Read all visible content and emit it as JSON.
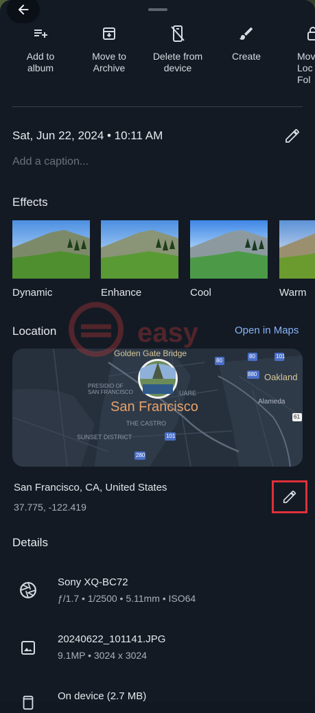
{
  "header": {
    "back_label": "Back"
  },
  "actions": [
    {
      "label": "Add to\nalbum",
      "icon": "playlist-add-icon"
    },
    {
      "label": "Move to\nArchive",
      "icon": "archive-icon"
    },
    {
      "label": "Delete from\ndevice",
      "icon": "phone-erase-icon"
    },
    {
      "label": "Create",
      "icon": "brush-icon"
    },
    {
      "label": "Move\nLoc\nFol",
      "icon": "lock-folder-icon"
    }
  ],
  "info": {
    "date": "Sat, Jun 22, 2024 • 10:11 AM",
    "caption_placeholder": "Add a caption..."
  },
  "effects": {
    "title": "Effects",
    "items": [
      "Dynamic",
      "Enhance",
      "Cool",
      "Warm"
    ]
  },
  "location": {
    "title": "Location",
    "open_maps": "Open in Maps",
    "place": "San Francisco, CA, United States",
    "coords": "37.775, -122.419",
    "map": {
      "city": "San Francisco",
      "golden_gate": "Golden Gate Bridge",
      "oakland": "Oakland",
      "alameda": "Alameda",
      "presidio": "PRESIDIO OF\nSAN FRANCISCO",
      "castro": "THE CASTRO",
      "sunset": "SUNSET DISTRICT",
      "square": "UARE",
      "shields": [
        "80",
        "80",
        "880",
        "280",
        "101",
        "101",
        "61"
      ]
    }
  },
  "watermark": "easy",
  "details": {
    "title": "Details",
    "camera": {
      "name": "Sony XQ-BC72",
      "specs": "ƒ/1.7  •  1/2500  •  5.11mm  •  ISO64"
    },
    "file": {
      "name": "20240622_101141.JPG",
      "specs": "9.1MP  •  3024 x 3024"
    },
    "storage": {
      "name": "On device (2.7 MB)"
    }
  }
}
